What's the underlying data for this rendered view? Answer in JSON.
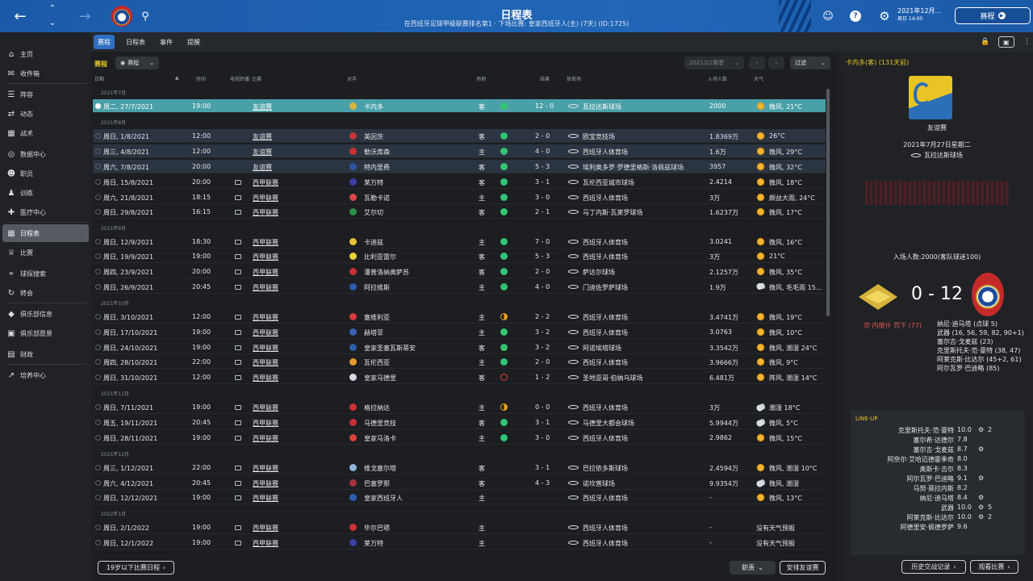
{
  "topbar": {
    "title": "日程表",
    "subtitle": "在西班牙足球甲级联赛排名第1 · 下场比赛: 皇家西班牙人(主) (7天) (ID:1725)",
    "date_line1": "2021年12月...",
    "date_line2": "周日 14:00",
    "continue_label": "赛程",
    "icons": [
      "back-icon",
      "up-icon",
      "down-icon",
      "forward-icon",
      "club-crest",
      "search-icon",
      "gear-icon",
      "help-icon",
      "settings-icon"
    ]
  },
  "nav": {
    "items": [
      {
        "label": "主页",
        "icon": "home-icon"
      },
      {
        "label": "收件箱",
        "icon": "inbox-icon"
      },
      {
        "label": "阵容",
        "icon": "squad-icon"
      },
      {
        "label": "动态",
        "icon": "dynamics-icon"
      },
      {
        "label": "战术",
        "icon": "tactics-icon"
      },
      {
        "label": "数据中心",
        "icon": "data-icon"
      },
      {
        "label": "职员",
        "icon": "staff-icon"
      },
      {
        "label": "训练",
        "icon": "training-icon"
      },
      {
        "label": "医疗中心",
        "icon": "medical-icon"
      },
      {
        "label": "日程表",
        "icon": "calendar-icon"
      },
      {
        "label": "比赛",
        "icon": "trophy-icon"
      },
      {
        "label": "球探搜索",
        "icon": "scouting-icon"
      },
      {
        "label": "转会",
        "icon": "transfer-icon"
      },
      {
        "label": "俱乐部信息",
        "icon": "club-info-icon"
      },
      {
        "label": "俱乐部愿景",
        "icon": "vision-icon"
      },
      {
        "label": "财政",
        "icon": "finance-icon"
      },
      {
        "label": "培养中心",
        "icon": "development-icon"
      }
    ]
  },
  "tabs": [
    "赛程",
    "日程表",
    "事件",
    "提醒"
  ],
  "toolbar": {
    "section_label": "赛程",
    "filter_label": "赛程",
    "season": "2021/22赛季",
    "filter_button": "过滤"
  },
  "columns": {
    "date": "日期",
    "time": "时间",
    "tv": "电视转播",
    "comp": "比赛",
    "opp": "对手",
    "venue": "场地",
    "result": "结果",
    "stadium": "体育场",
    "att": "入场人数",
    "weather": "天气"
  },
  "months": [
    "2021年7月",
    "2021年8月",
    "2021年9月",
    "2021年10月",
    "2021年11月",
    "2021年12月",
    "2022年1月"
  ],
  "fixtures": [
    {
      "date": "周二, 27/7/2021",
      "time": "19:00",
      "tv": false,
      "comp": "友谊赛",
      "opp": "卡内多",
      "opp_color": "#d9b53a",
      "venue": "客",
      "res": "w",
      "score": "12 - 0",
      "stadium": "瓦拉达斯球场",
      "att": "2000",
      "weather": "微风, 21°C",
      "wicon": "sun"
    },
    {
      "date": "周日, 1/8/2021",
      "time": "12:00",
      "tv": false,
      "comp": "友谊赛",
      "opp": "美因茨",
      "opp_color": "#c4343a",
      "venue": "客",
      "res": "w",
      "score": "2 - 0",
      "stadium": "欧宝竞技场",
      "att": "1.8369万",
      "weather": "26°C",
      "wicon": "sun"
    },
    {
      "date": "周三, 4/8/2021",
      "time": "12:00",
      "tv": false,
      "comp": "友谊赛",
      "opp": "勒沃库森",
      "opp_color": "#c93030",
      "venue": "主",
      "res": "w",
      "score": "4 - 0",
      "stadium": "西班牙人体育场",
      "att": "1.6万",
      "weather": "微风, 29°C",
      "wicon": "sun"
    },
    {
      "date": "周六, 7/8/2021",
      "time": "20:00",
      "tv": false,
      "comp": "友谊赛",
      "opp": "特内里费",
      "opp_color": "#2c57a0",
      "venue": "客",
      "res": "w",
      "score": "5 - 3",
      "stadium": "埃利奥多罗·罗德里格斯·洛佩兹球场",
      "att": "3957",
      "weather": "微风, 32°C",
      "wicon": "sun"
    },
    {
      "date": "周日, 15/8/2021",
      "time": "20:00",
      "tv": true,
      "comp": "西甲联赛",
      "opp": "莱万特",
      "opp_color": "#3a3fa3",
      "venue": "客",
      "res": "w",
      "score": "3 - 1",
      "stadium": "瓦伦西亚城市球场",
      "att": "2.4214",
      "weather": "微风, 18°C",
      "wicon": "sun"
    },
    {
      "date": "周六, 21/8/2021",
      "time": "18:15",
      "tv": true,
      "comp": "西甲联赛",
      "opp": "瓦勒卡诺",
      "opp_color": "#d9464a",
      "venue": "主",
      "res": "w",
      "score": "3 - 0",
      "stadium": "西班牙人体育场",
      "att": "3万",
      "weather": "颇益大雨, 24°C",
      "wicon": "sun"
    },
    {
      "date": "周日, 29/8/2021",
      "time": "16:15",
      "tv": true,
      "comp": "西甲联赛",
      "opp": "艾尔切",
      "opp_color": "#2f8d4a",
      "venue": "客",
      "res": "w",
      "score": "2 - 1",
      "stadium": "马丁内斯·瓦莱罗球场",
      "att": "1.6237万",
      "weather": "微风, 17°C",
      "wicon": "sun"
    },
    {
      "date": "周日, 12/9/2021",
      "time": "18:30",
      "tv": true,
      "comp": "西甲联赛",
      "opp": "卡迪兹",
      "opp_color": "#e3c23a",
      "venue": "主",
      "res": "w",
      "score": "7 - 0",
      "stadium": "西班牙人体育场",
      "att": "3.0241",
      "weather": "微风, 16°C",
      "wicon": "sun"
    },
    {
      "date": "周日, 19/9/2021",
      "time": "19:00",
      "tv": true,
      "comp": "西甲联赛",
      "opp": "比利亚雷尔",
      "opp_color": "#e6d23a",
      "venue": "客",
      "res": "w",
      "score": "5 - 3",
      "stadium": "西班牙人体育场",
      "att": "3万",
      "weather": "21°C",
      "wicon": "sun"
    },
    {
      "date": "周四, 23/9/2021",
      "time": "20:00",
      "tv": true,
      "comp": "西甲联赛",
      "opp": "潘普洛纳奥萨苏",
      "opp_color": "#c3303a",
      "venue": "客",
      "res": "w",
      "score": "2 - 0",
      "stadium": "萨达尔球场",
      "att": "2.1257万",
      "weather": "微风, 35°C",
      "wicon": "sun"
    },
    {
      "date": "周日, 26/9/2021",
      "time": "20:45",
      "tv": true,
      "comp": "西甲联赛",
      "opp": "阿拉维斯",
      "opp_color": "#2d5aa6",
      "venue": "主",
      "res": "w",
      "score": "4 - 0",
      "stadium": "门迪佐罗萨球场",
      "att": "1.9万",
      "weather": "微风, 毛毛雨 15...",
      "wicon": "rain"
    },
    {
      "date": "周日, 3/10/2021",
      "time": "12:00",
      "tv": true,
      "comp": "西甲联赛",
      "opp": "塞维利亚",
      "opp_color": "#d8393c",
      "venue": "主",
      "res": "d",
      "score": "2 - 2",
      "stadium": "西班牙人体育场",
      "att": "3.4741万",
      "weather": "微风, 19°C",
      "wicon": "sun"
    },
    {
      "date": "周日, 17/10/2021",
      "time": "19:00",
      "tv": true,
      "comp": "西甲联赛",
      "opp": "赫塔菲",
      "opp_color": "#3b5fb0",
      "venue": "主",
      "res": "w",
      "score": "3 - 2",
      "stadium": "西班牙人体育场",
      "att": "3.0763",
      "weather": "微风, 10°C",
      "wicon": "sun"
    },
    {
      "date": "周日, 24/10/2021",
      "time": "19:00",
      "tv": true,
      "comp": "西甲联赛",
      "opp": "皇家圣塞瓦斯蒂安",
      "opp_color": "#2e5ea8",
      "venue": "客",
      "res": "w",
      "score": "3 - 2",
      "stadium": "阿诺埃塔球场",
      "att": "3.3542万",
      "weather": "微风, 潮湿 24°C",
      "wicon": "sun"
    },
    {
      "date": "周四, 28/10/2021",
      "time": "22:00",
      "tv": true,
      "comp": "西甲联赛",
      "opp": "瓦伦西亚",
      "opp_color": "#e49a2e",
      "venue": "主",
      "res": "w",
      "score": "2 - 0",
      "stadium": "西班牙人体育场",
      "att": "3.9666万",
      "weather": "微风, 9°C",
      "wicon": "sun"
    },
    {
      "date": "周日, 31/10/2021",
      "time": "12:00",
      "tv": true,
      "comp": "西甲联赛",
      "opp": "皇家马德里",
      "opp_color": "#d8d8e6",
      "venue": "客",
      "res": "l",
      "score": "1 - 2",
      "stadium": "圣地亚哥·伯纳乌球场",
      "att": "6.481万",
      "weather": "阵风, 潮湿 14°C",
      "wicon": "sun"
    },
    {
      "date": "周日, 7/11/2021",
      "time": "19:00",
      "tv": true,
      "comp": "西甲联赛",
      "opp": "格拉纳达",
      "opp_color": "#c8343a",
      "venue": "主",
      "res": "d",
      "score": "0 - 0",
      "stadium": "西班牙人体育场",
      "att": "3万",
      "weather": "潮湿 18°C",
      "wicon": "cloud"
    },
    {
      "date": "周五, 19/11/2021",
      "time": "20:45",
      "tv": true,
      "comp": "西甲联赛",
      "opp": "马德里竞技",
      "opp_color": "#c62f38",
      "venue": "客",
      "res": "w",
      "score": "3 - 1",
      "stadium": "马德里大都会球场",
      "att": "5.9944万",
      "weather": "微风, 5°C",
      "wicon": "cloud"
    },
    {
      "date": "周日, 28/11/2021",
      "time": "19:00",
      "tv": true,
      "comp": "西甲联赛",
      "opp": "皇家马洛卡",
      "opp_color": "#d7433a",
      "venue": "主",
      "res": "w",
      "score": "3 - 0",
      "stadium": "西班牙人体育场",
      "att": "2.9862",
      "weather": "微风, 15°C",
      "wicon": "sun"
    },
    {
      "date": "周三, 1/12/2021",
      "time": "22:00",
      "tv": true,
      "comp": "西甲联赛",
      "opp": "维戈塞尔塔",
      "opp_color": "#8fb6dc",
      "venue": "客",
      "res": "",
      "score": "3 - 1",
      "stadium": "巴拉依多斯球场",
      "att": "2.4594万",
      "weather": "微风, 潮湿 10°C",
      "wicon": "sun"
    },
    {
      "date": "周六, 4/12/2021",
      "time": "20:45",
      "tv": true,
      "comp": "西甲联赛",
      "opp": "巴塞罗那",
      "opp_color": "#a5303e",
      "venue": "客",
      "res": "",
      "score": "4 - 3",
      "stadium": "诺坎普球场",
      "att": "9.9354万",
      "weather": "微风, 潮湿",
      "wicon": "cloud"
    },
    {
      "date": "周日, 12/12/2021",
      "time": "19:00",
      "tv": true,
      "comp": "西甲联赛",
      "opp": "皇家西班牙人",
      "opp_color": "#2c5fb0",
      "venue": "主",
      "res": "",
      "score": "",
      "stadium": "西班牙人体育场",
      "att": "-",
      "weather": "微风, 13°C",
      "wicon": "sun"
    },
    {
      "date": "周日, 2/1/2022",
      "time": "19:00",
      "tv": true,
      "comp": "西甲联赛",
      "opp": "毕尔巴鄂",
      "opp_color": "#c8303a",
      "venue": "主",
      "res": "",
      "score": "",
      "stadium": "西班牙人体育场",
      "att": "-",
      "weather": "没有天气预报",
      "wicon": ""
    },
    {
      "date": "周日, 12/1/2022",
      "time": "19:00",
      "tv": true,
      "comp": "西甲联赛",
      "opp": "莱万特",
      "opp_color": "#3a3fa3",
      "venue": "主",
      "res": "",
      "score": "",
      "stadium": "西班牙人体育场",
      "att": "-",
      "weather": "没有天气预报",
      "wicon": ""
    }
  ],
  "footer": {
    "u19_label": "19岁以下比赛日程",
    "staff_label": "职责",
    "friendly_label": "安排友谊赛"
  },
  "right": {
    "title": "卡内多(客) (131天前)",
    "match_type": "友谊赛",
    "match_date": "2021年7月27日星期二",
    "stadium": "瓦拉达斯球场",
    "attendance": "入场人数:2000(客队球迷100)",
    "score": "0 - 12",
    "home_scorer": "京·内维什 罚下 (77)",
    "away_scorers": [
      "纳尼·迪马塔 (点球 5)",
      "武器 (16, 56, 59, 82, 90+1)",
      "塞尔吉·戈麦兹 (23)",
      "克里斯托夫·范·豪特 (38, 47)",
      "阿莱克斯·比达尔 (45+2, 61)",
      "阿尔瓦罗·巴迪略 (85)"
    ],
    "lineup_title": "LINE-UP",
    "lineup": [
      {
        "name": "克里斯托夫·范·豪特",
        "rating": "10.0",
        "extra": "2"
      },
      {
        "name": "塞尔希·达德尔",
        "rating": "7.8",
        "extra": ""
      },
      {
        "name": "塞尔吉·戈麦兹",
        "rating": "8.7",
        "extra": "1"
      },
      {
        "name": "阿奈尔·艾哈迈德霍季奇",
        "rating": "8.0",
        "extra": ""
      },
      {
        "name": "奥斯卡·吉尔",
        "rating": "8.3",
        "extra": ""
      },
      {
        "name": "阿尔瓦罗·巴迪略",
        "rating": "9.1",
        "extra": "1"
      },
      {
        "name": "马努·莫拉内斯",
        "rating": "8.2",
        "extra": ""
      },
      {
        "name": "纳尼·迪马塔",
        "rating": "8.4",
        "extra": "1"
      },
      {
        "name": "武器",
        "rating": "10.0",
        "extra": "5"
      },
      {
        "name": "阿莱克斯·比达尔",
        "rating": "10.0",
        "extra": "2"
      },
      {
        "name": "阿德里安·佩德罗萨",
        "rating": "9.6",
        "extra": ""
      }
    ],
    "history_label": "历史交战记录",
    "view_label": "观看比赛"
  }
}
